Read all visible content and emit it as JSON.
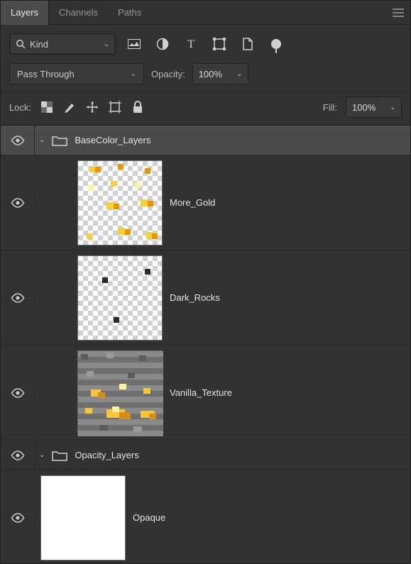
{
  "tabs": {
    "layers": "Layers",
    "channels": "Channels",
    "paths": "Paths"
  },
  "filter": {
    "kind_label": "Kind",
    "icons": [
      "image-filter",
      "mask-filter",
      "text-filter",
      "shape-filter",
      "smart-filter",
      "artboard-filter"
    ]
  },
  "blend": {
    "mode": "Pass Through",
    "opacity_label": "Opacity:",
    "opacity_value": "100%"
  },
  "lock": {
    "label": "Lock:",
    "fill_label": "Fill:",
    "fill_value": "100%"
  },
  "groups": {
    "basecolor": {
      "name": "BaseColor_Layers"
    },
    "opacity": {
      "name": "Opacity_Layers"
    }
  },
  "layers": {
    "more_gold": "More_Gold",
    "dark_rocks": "Dark_Rocks",
    "vanilla": "Vanilla_Texture",
    "opaque": "Opaque"
  }
}
